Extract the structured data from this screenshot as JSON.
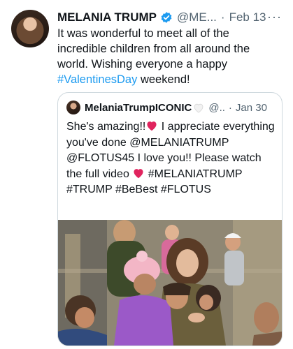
{
  "tweet": {
    "name": "MELANIA TRUMP",
    "handle": "@ME...",
    "separator": "·",
    "date": "Feb 13",
    "more": "···",
    "text_before": "It was wonderful to meet all of the incredible children from all around the world. Wishing everyone a happy ",
    "hashtag": "#ValentinesDay",
    "text_after": " weekend!"
  },
  "quote": {
    "name": "MelaniaTrumpICONIC",
    "handle": "@..",
    "separator": "·",
    "date": "Jan 30",
    "text_part1": "She's amazing!!",
    "text_part2": " I appreciate everything you've done @MELANIATRUMP @FLOTUS45 I love you!! Please watch the full video ",
    "text_part3": " #MELANIATRUMP #TRUMP #BeBest #FLOTUS"
  },
  "colors": {
    "link": "#1d9bf0",
    "verified": "#1d9bf0",
    "heart": "#e0245e"
  }
}
